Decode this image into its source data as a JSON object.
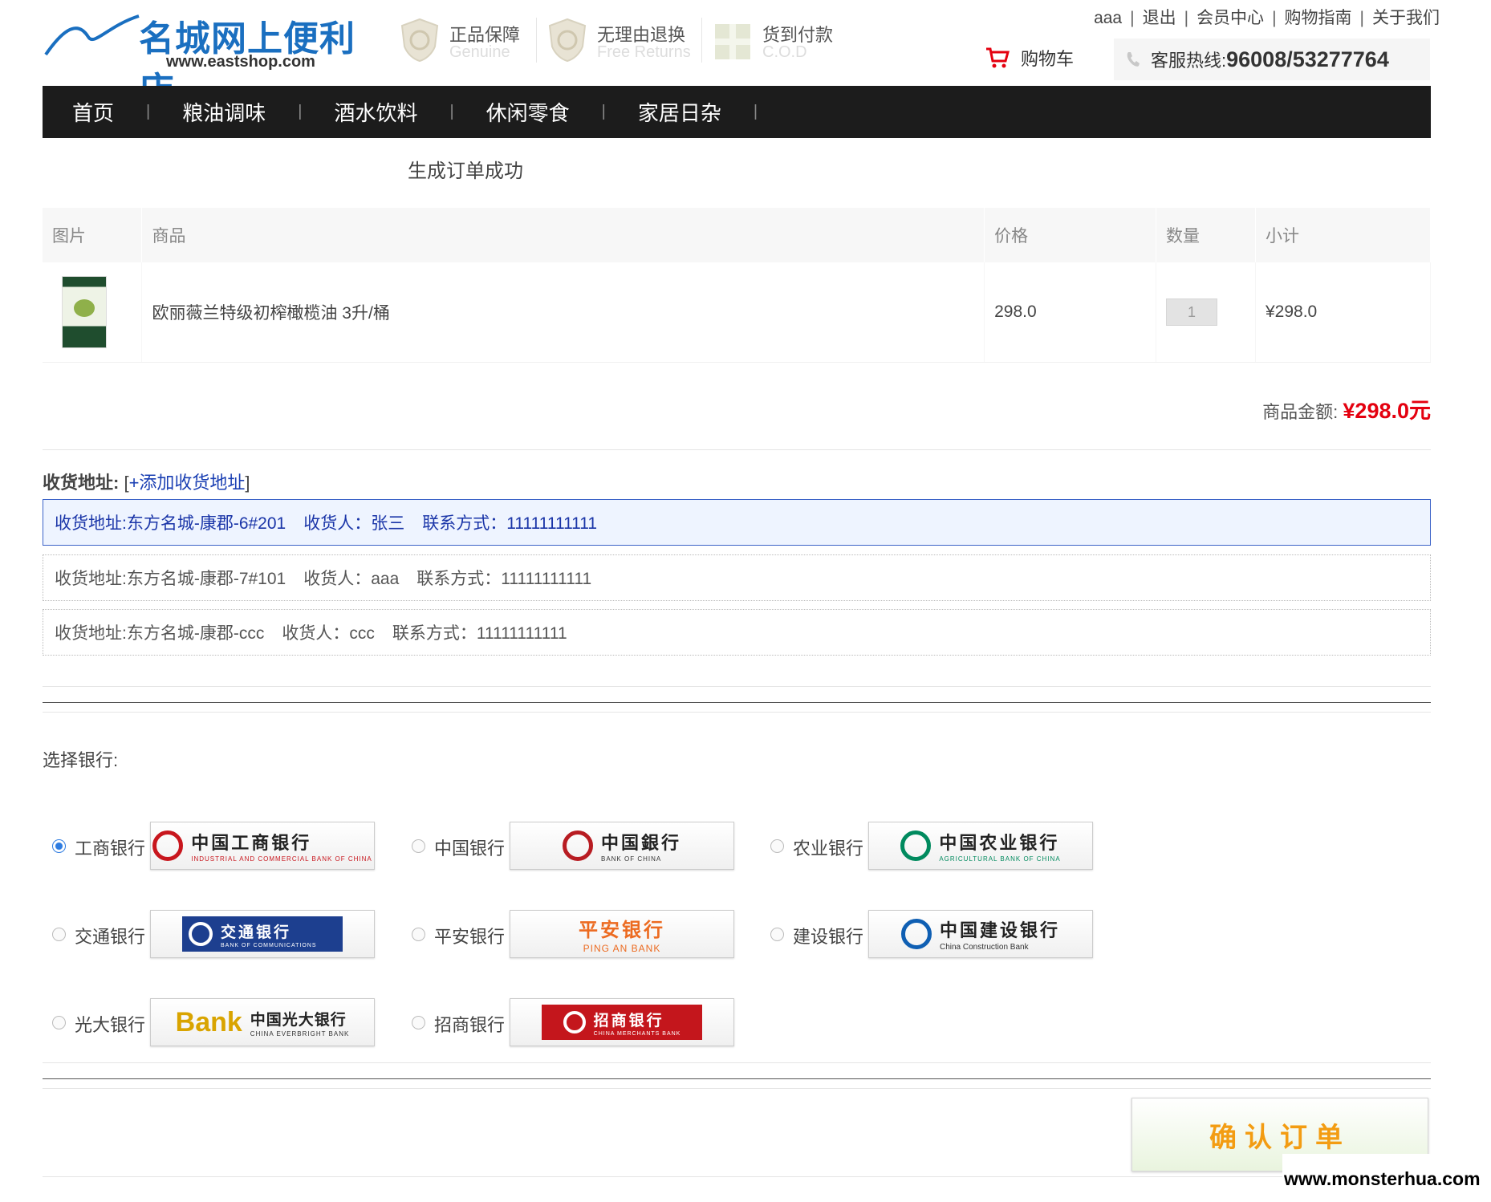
{
  "header": {
    "logo_title": "名城网上便利店",
    "logo_url": "www.eastshop.com",
    "badges": [
      {
        "title": "正品保障",
        "sub": "Genuine",
        "icon": "shield-genuine-icon"
      },
      {
        "title": "无理由退换",
        "sub": "Free Returns",
        "icon": "shield-return-icon"
      },
      {
        "title": "货到付款",
        "sub": "C.O.D",
        "icon": "gift-cod-icon"
      }
    ],
    "top_links": [
      "aaa",
      "退出",
      "会员中心",
      "购物指南",
      "关于我们"
    ],
    "cart_label": "购物车",
    "hotline_label": "客服热线:",
    "hotline_number": "96008/53277764"
  },
  "nav": [
    "首页",
    "粮油调味",
    "酒水饮料",
    "休闲零食",
    "家居日杂"
  ],
  "order": {
    "success_msg": "生成订单成功",
    "columns": [
      "图片",
      "商品",
      "价格",
      "数量",
      "小计"
    ],
    "items": [
      {
        "name": "欧丽薇兰特级初榨橄榄油 3升/桶",
        "price": "298.0",
        "qty": "1",
        "subtotal": "¥298.0"
      }
    ],
    "total_label": "商品金额:",
    "total_amount": "¥298.0元"
  },
  "address": {
    "label": "收货地址:",
    "add_link": "+添加收货地址",
    "list": [
      {
        "addr": "收货地址:东方名城-康郡-6#201",
        "receiver": "收货人：张三",
        "contact": "联系方式：11111111111",
        "selected": true
      },
      {
        "addr": "收货地址:东方名城-康郡-7#101",
        "receiver": "收货人：aaa",
        "contact": "联系方式：11111111111",
        "selected": false
      },
      {
        "addr": "收货地址:东方名城-康郡-ccc",
        "receiver": "收货人：ccc",
        "contact": "联系方式：11111111111",
        "selected": false
      }
    ]
  },
  "bank": {
    "label": "选择银行:",
    "options": [
      {
        "name": "工商银行",
        "logo_cn": "中国工商银行",
        "logo_en": "INDUSTRIAL AND COMMERCIAL BANK OF CHINA",
        "color": "#c8161d",
        "selected": true
      },
      {
        "name": "中国银行",
        "logo_cn": "中国銀行",
        "logo_en": "BANK OF CHINA",
        "color": "#b81c22",
        "selected": false
      },
      {
        "name": "农业银行",
        "logo_cn": "中国农业银行",
        "logo_en": "AGRICULTURAL BANK OF CHINA",
        "color": "#008a5e",
        "selected": false
      },
      {
        "name": "交通银行",
        "logo_cn": "交通银行",
        "logo_en": "BANK OF COMMUNICATIONS",
        "color": "#1d3f8f",
        "selected": false
      },
      {
        "name": "平安银行",
        "logo_cn": "平安银行",
        "logo_en": "PING AN BANK",
        "color": "#ec6b21",
        "selected": false
      },
      {
        "name": "建设银行",
        "logo_cn": "中国建设银行",
        "logo_en": "China Construction Bank",
        "color": "#0f5fb3",
        "selected": false
      },
      {
        "name": "光大银行",
        "logo_cn": "中国光大银行",
        "logo_en": "CHINA EVERBRIGHT BANK",
        "color": "#d9a400",
        "selected": false
      },
      {
        "name": "招商银行",
        "logo_cn": "招商银行",
        "logo_en": "CHINA MERCHANTS BANK",
        "color": "#c4161c",
        "selected": false
      }
    ]
  },
  "confirm_label": "确认订单",
  "watermark": "www.monsterhua.com",
  "colors": {
    "nav_bg": "#1c1c1c",
    "price_red": "#e4000f",
    "brand_blue": "#1a6fc0",
    "confirm_orange": "#f39c12"
  }
}
